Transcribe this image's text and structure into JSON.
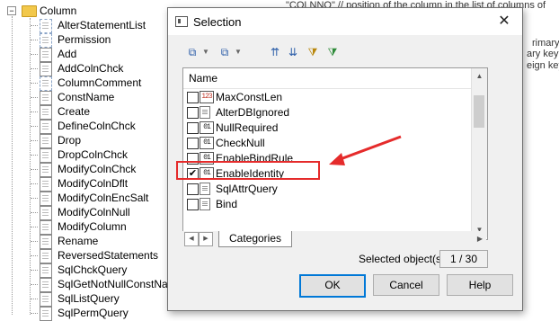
{
  "tree": {
    "root_label": "Column",
    "items": [
      {
        "label": "AlterStatementList",
        "style": "dashed"
      },
      {
        "label": "Permission",
        "style": "dashed"
      },
      {
        "label": "Add",
        "style": "doc"
      },
      {
        "label": "AddColnChck",
        "style": "doc"
      },
      {
        "label": "ColumnComment",
        "style": "dashed"
      },
      {
        "label": "ConstName",
        "style": "doc"
      },
      {
        "label": "Create",
        "style": "doc"
      },
      {
        "label": "DefineColnChck",
        "style": "doc"
      },
      {
        "label": "Drop",
        "style": "doc"
      },
      {
        "label": "DropColnChck",
        "style": "doc"
      },
      {
        "label": "ModifyColnChck",
        "style": "doc"
      },
      {
        "label": "ModifyColnDflt",
        "style": "doc"
      },
      {
        "label": "ModifyColnEncSalt",
        "style": "doc"
      },
      {
        "label": "ModifyColnNull",
        "style": "doc"
      },
      {
        "label": "ModifyColumn",
        "style": "doc"
      },
      {
        "label": "Rename",
        "style": "doc"
      },
      {
        "label": "ReversedStatements",
        "style": "doc"
      },
      {
        "label": "SqlChckQuery",
        "style": "doc"
      },
      {
        "label": "SqlGetNotNullConstName",
        "style": "doc"
      },
      {
        "label": "SqlListQuery",
        "style": "doc"
      },
      {
        "label": "SqlPermQuery",
        "style": "doc"
      }
    ]
  },
  "background_text": {
    "code_line": "\"COLNNO\"     // position of the column in the list of columns of",
    "lines": [
      "rimary",
      "ary key",
      "eign key"
    ]
  },
  "dialog": {
    "title": "Selection",
    "close_glyph": "✕",
    "list_header": "Name",
    "rows": [
      {
        "label": "MaxConstLen",
        "icon": "123",
        "kind": "num",
        "checked": false
      },
      {
        "label": "AlterDBIgnored",
        "icon": "",
        "kind": "doc",
        "checked": false
      },
      {
        "label": "NullRequired",
        "icon": "01",
        "kind": "bool",
        "checked": false
      },
      {
        "label": "CheckNull",
        "icon": "01",
        "kind": "bool",
        "checked": false
      },
      {
        "label": "EnableBindRule",
        "icon": "01",
        "kind": "bool",
        "checked": false
      },
      {
        "label": "EnableIdentity",
        "icon": "01",
        "kind": "bool",
        "checked": true
      },
      {
        "label": "SqlAttrQuery",
        "icon": "",
        "kind": "doc",
        "checked": false
      },
      {
        "label": "Bind",
        "icon": "",
        "kind": "doc",
        "checked": false
      }
    ],
    "tab_label": "Categories",
    "selected_label": "Selected object(s):",
    "selected_count": "1 / 30",
    "ok_label": "OK",
    "cancel_label": "Cancel",
    "help_label": "Help"
  },
  "colors": {
    "annotation_red": "#e52b2b",
    "default_button_border": "#0078d7",
    "folder_yellow": "#f2c84b"
  }
}
